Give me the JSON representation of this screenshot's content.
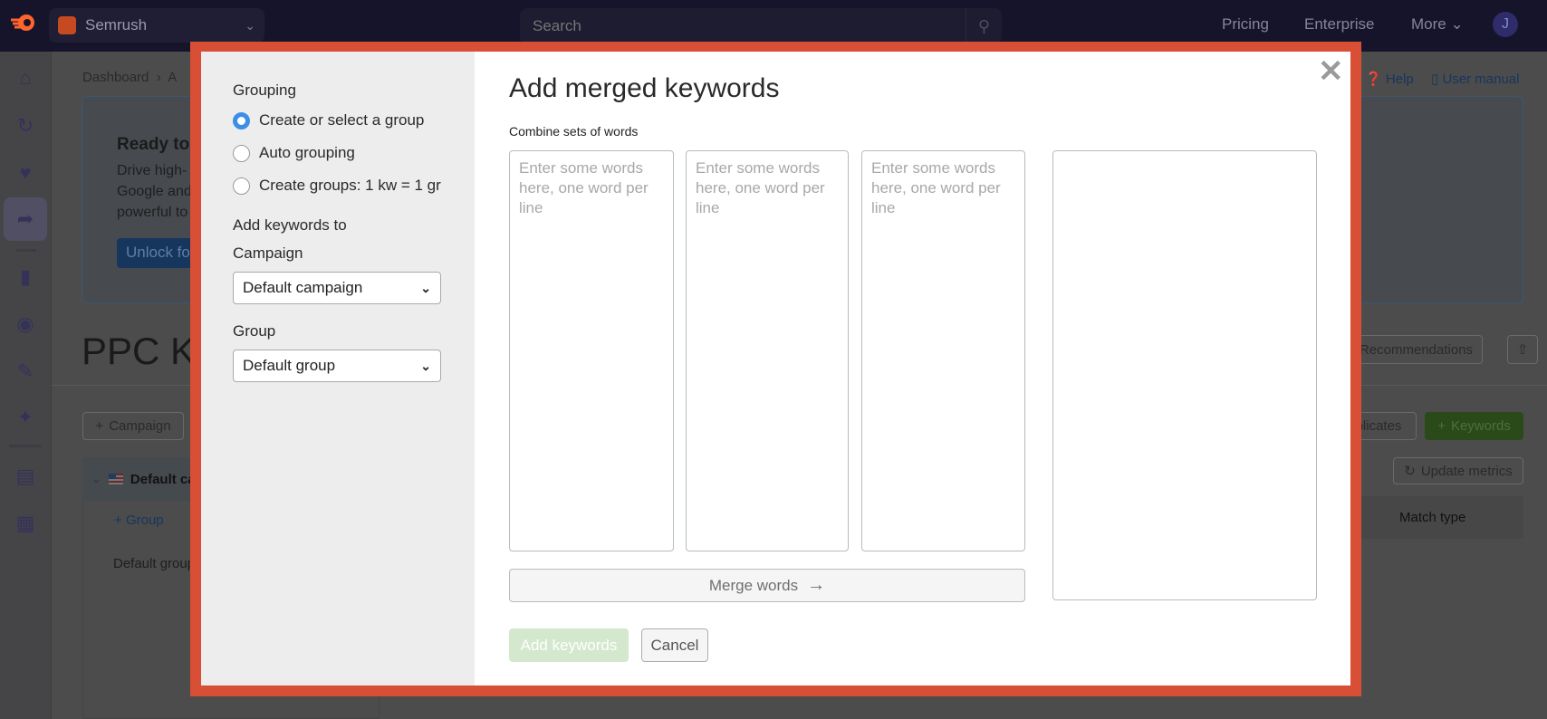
{
  "topnav": {
    "project": "Semrush",
    "search_placeholder": "Search",
    "links": [
      "Pricing",
      "Enterprise",
      "More"
    ],
    "avatar_initial": "J"
  },
  "background": {
    "breadcrumb": [
      "Dashboard",
      "A"
    ],
    "help": "Help",
    "user_manual": "User manual",
    "banner": {
      "title": "Ready to",
      "lines": [
        "Drive high-",
        "Google and",
        "powerful to"
      ],
      "button": "Unlock fo"
    },
    "page_title": "PPC Ke",
    "recommendations": "Recommendations",
    "add_campaign": "Campaign",
    "duplicates": "plicates",
    "add_keywords": "Keywords",
    "update_metrics": "Update metrics",
    "campaign_row": "Default ca",
    "add_group": "Group",
    "group_row": "Default group",
    "match_type": "Match type"
  },
  "modal": {
    "title": "Add merged keywords",
    "grouping_label": "Grouping",
    "grouping_options": [
      {
        "label": "Create or select a group",
        "selected": true
      },
      {
        "label": "Auto grouping",
        "selected": false
      },
      {
        "label": "Create groups: 1 kw = 1 gr",
        "selected": false
      }
    ],
    "add_to_label": "Add keywords to",
    "campaign_label": "Campaign",
    "campaign_value": "Default campaign",
    "group_label": "Group",
    "group_value": "Default group",
    "combine_label": "Combine sets of words",
    "textarea_placeholder": "Enter some words here, one word per line",
    "merge_button": "Merge words",
    "add_keywords_button": "Add keywords",
    "cancel_button": "Cancel"
  },
  "colors": {
    "frame": "#d94f35",
    "primary_disabled": "#d3e8cc",
    "radio_selected": "#3d8fe6"
  }
}
